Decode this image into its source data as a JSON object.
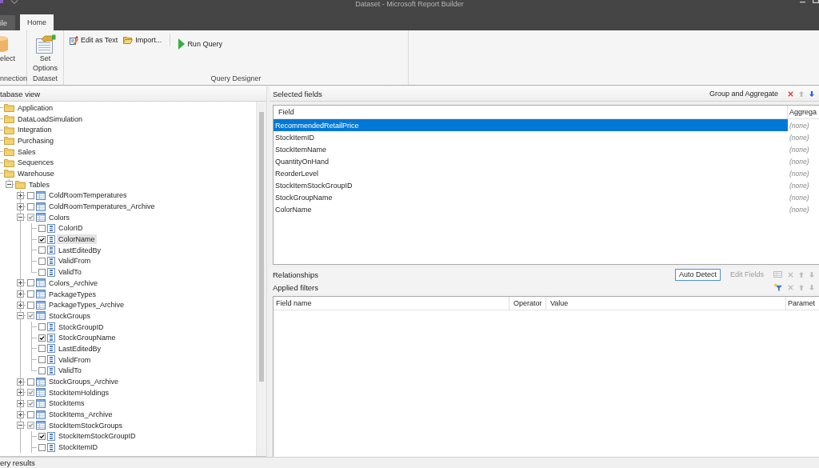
{
  "window": {
    "title": "Dataset - Microsoft Report Builder"
  },
  "ribbon": {
    "tabs": [
      {
        "label": "ile",
        "selected": false
      },
      {
        "label": "Home",
        "selected": true
      }
    ],
    "groups": [
      {
        "label": "nnection",
        "buttons": [
          {
            "label": "elect",
            "kind": "large"
          }
        ]
      },
      {
        "label": "Dataset",
        "buttons": [
          {
            "label": "Set Options",
            "kind": "large"
          }
        ]
      },
      {
        "label": "Query Designer",
        "buttons": [
          {
            "label": "Edit as Text",
            "kind": "small"
          },
          {
            "label": "Import...",
            "kind": "small"
          },
          {
            "label": "Run Query",
            "kind": "run"
          }
        ]
      }
    ]
  },
  "database_view": {
    "title": "tabase view",
    "tree": [
      {
        "kind": "folder",
        "label": "Application",
        "selected": false
      },
      {
        "kind": "folder",
        "label": "DataLoadSimulation",
        "selected": false
      },
      {
        "kind": "folder",
        "label": "Integration",
        "selected": false
      },
      {
        "kind": "folder",
        "label": "Purchasing",
        "selected": false
      },
      {
        "kind": "folder",
        "label": "Sales",
        "selected": false
      },
      {
        "kind": "folder",
        "label": "Sequences",
        "selected": false
      },
      {
        "kind": "folder",
        "label": "Warehouse",
        "selected": false,
        "children": [
          {
            "kind": "folder",
            "label": "Tables",
            "expanded": true,
            "selected": false,
            "children": [
              {
                "kind": "table",
                "label": "ColdRoomTemperatures",
                "expanded": false,
                "checked": false,
                "partial": false,
                "selected": false
              },
              {
                "kind": "table",
                "label": "ColdRoomTemperatures_Archive",
                "expanded": false,
                "checked": false,
                "partial": false,
                "selected": false
              },
              {
                "kind": "table",
                "label": "Colors",
                "expanded": true,
                "checked": false,
                "partial": true,
                "selected": false,
                "children": [
                  {
                    "kind": "column",
                    "label": "ColorID",
                    "checked": false,
                    "selected": false
                  },
                  {
                    "kind": "column",
                    "label": "ColorName",
                    "checked": true,
                    "selected": true
                  },
                  {
                    "kind": "column",
                    "label": "LastEditedBy",
                    "checked": false,
                    "selected": false
                  },
                  {
                    "kind": "column",
                    "label": "ValidFrom",
                    "checked": false,
                    "selected": false
                  },
                  {
                    "kind": "column",
                    "label": "ValidTo",
                    "checked": false,
                    "selected": false
                  }
                ]
              },
              {
                "kind": "table",
                "label": "Colors_Archive",
                "expanded": false,
                "checked": false,
                "partial": false,
                "selected": false
              },
              {
                "kind": "table",
                "label": "PackageTypes",
                "expanded": false,
                "checked": false,
                "partial": false,
                "selected": false
              },
              {
                "kind": "table",
                "label": "PackageTypes_Archive",
                "expanded": false,
                "checked": false,
                "partial": false,
                "selected": false
              },
              {
                "kind": "table",
                "label": "StockGroups",
                "expanded": true,
                "checked": false,
                "partial": true,
                "selected": false,
                "children": [
                  {
                    "kind": "column",
                    "label": "StockGroupID",
                    "checked": false,
                    "selected": false
                  },
                  {
                    "kind": "column",
                    "label": "StockGroupName",
                    "checked": true,
                    "selected": false
                  },
                  {
                    "kind": "column",
                    "label": "LastEditedBy",
                    "checked": false,
                    "selected": false
                  },
                  {
                    "kind": "column",
                    "label": "ValidFrom",
                    "checked": false,
                    "selected": false
                  },
                  {
                    "kind": "column",
                    "label": "ValidTo",
                    "checked": false,
                    "selected": false
                  }
                ]
              },
              {
                "kind": "table",
                "label": "StockGroups_Archive",
                "expanded": false,
                "checked": false,
                "partial": false,
                "selected": false
              },
              {
                "kind": "table",
                "label": "StockItemHoldings",
                "expanded": false,
                "checked": false,
                "partial": true,
                "selected": false
              },
              {
                "kind": "table",
                "label": "StockItems",
                "expanded": false,
                "checked": false,
                "partial": true,
                "selected": false
              },
              {
                "kind": "table",
                "label": "StockItems_Archive",
                "expanded": false,
                "checked": false,
                "partial": false,
                "selected": false
              },
              {
                "kind": "table",
                "label": "StockItemStockGroups",
                "expanded": true,
                "checked": false,
                "partial": true,
                "selected": false,
                "children": [
                  {
                    "kind": "column",
                    "label": "StockItemStockGroupID",
                    "checked": true,
                    "selected": false
                  },
                  {
                    "kind": "column",
                    "label": "StockItemID",
                    "checked": false,
                    "selected": false
                  }
                ]
              }
            ]
          }
        ]
      }
    ]
  },
  "selected_fields": {
    "title": "Selected fields",
    "buttons": [
      {
        "label": "Group and Aggregate",
        "on": false,
        "disabled": false
      }
    ],
    "tools": [
      {
        "kind": "delete",
        "disabled": false
      },
      {
        "kind": "up",
        "disabled": true
      },
      {
        "kind": "down",
        "disabled": false
      }
    ],
    "columns": [
      "Field",
      "Aggrega"
    ],
    "rows": [
      {
        "field": "RecommendedRetailPrice",
        "aggregate": "(none)",
        "selected": true
      },
      {
        "field": "StockItemID",
        "aggregate": "(none)",
        "selected": false
      },
      {
        "field": "StockItemName",
        "aggregate": "(none)",
        "selected": false
      },
      {
        "field": "QuantityOnHand",
        "aggregate": "(none)",
        "selected": false
      },
      {
        "field": "ReorderLevel",
        "aggregate": "(none)",
        "selected": false
      },
      {
        "field": "StockItemStockGroupID",
        "aggregate": "(none)",
        "selected": false
      },
      {
        "field": "StockGroupName",
        "aggregate": "(none)",
        "selected": false
      },
      {
        "field": "ColorName",
        "aggregate": "(none)",
        "selected": false
      }
    ]
  },
  "relationships": {
    "title": "Relationships",
    "buttons": [
      {
        "label": "Auto Detect",
        "on": true,
        "disabled": false
      },
      {
        "label": "Edit Fields",
        "on": false,
        "disabled": true
      }
    ],
    "tools": [
      {
        "kind": "edit",
        "disabled": true
      },
      {
        "kind": "delete",
        "disabled": true
      },
      {
        "kind": "up",
        "disabled": true
      },
      {
        "kind": "down",
        "disabled": true
      }
    ]
  },
  "applied_filters": {
    "title": "Applied filters",
    "tools": [
      {
        "kind": "filter",
        "disabled": false
      },
      {
        "kind": "delete",
        "disabled": true
      },
      {
        "kind": "up",
        "disabled": true
      },
      {
        "kind": "down",
        "disabled": true
      }
    ],
    "columns": [
      "Field name",
      "Operator",
      "Value",
      "Paramet"
    ]
  },
  "query_results": {
    "title": "ery results"
  }
}
